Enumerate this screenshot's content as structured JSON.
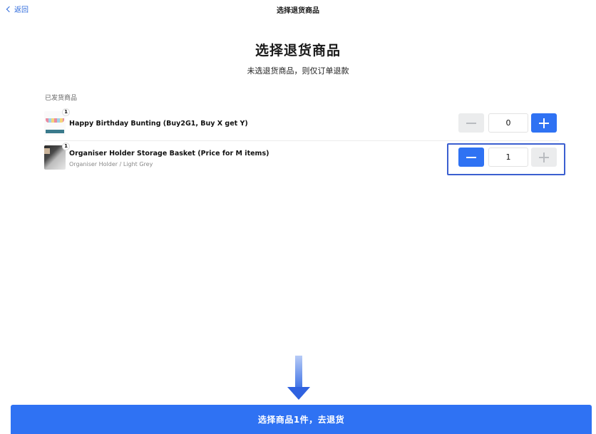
{
  "nav": {
    "back_label": "返回",
    "title": "选择退货商品"
  },
  "header": {
    "title": "选择退货商品",
    "subtitle": "未选退货商品，则仅订单退款"
  },
  "section": {
    "label": "已发货商品"
  },
  "items": [
    {
      "name": "Happy Birthday Bunting (Buy2G1, Buy X get Y)",
      "variant": "",
      "ordered_qty": "1",
      "selected_qty": "0",
      "minus_enabled": false,
      "plus_enabled": true,
      "thumbnail_icon": "bunting-image"
    },
    {
      "name": "Organiser Holder Storage Basket (Price for M items)",
      "variant": "Organiser Holder  / Light Grey",
      "ordered_qty": "1",
      "selected_qty": "1",
      "minus_enabled": true,
      "plus_enabled": false,
      "thumbnail_icon": "storage-basket-image"
    }
  ],
  "footer": {
    "submit_label": "选择商品1件，去退货"
  },
  "colors": {
    "accent": "#2f72f3",
    "link": "#2f6bdc",
    "highlight": "#3b5fd0",
    "disabled_bg": "#ebeced"
  }
}
